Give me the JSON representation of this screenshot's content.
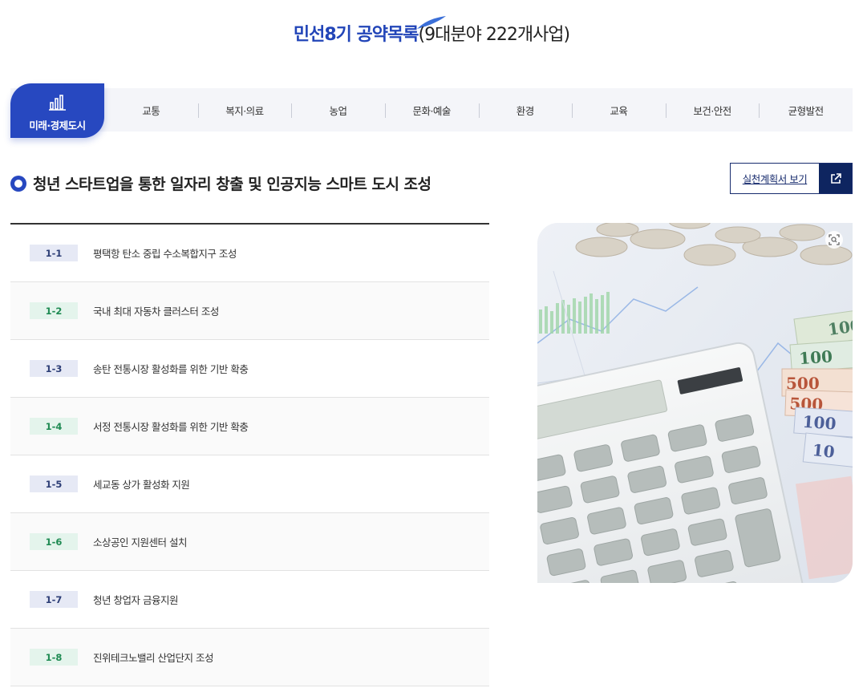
{
  "header": {
    "title_bold": "민선8기 공약목록",
    "title_rest": "(9대분야 222개사업)"
  },
  "nav": {
    "active": {
      "label": "미래·경제도시",
      "icon": "bar-chart-icon"
    },
    "items": [
      "교통",
      "복지·의료",
      "농업",
      "문화·예술",
      "환경",
      "교육",
      "보건·안전",
      "균형발전"
    ]
  },
  "section": {
    "title": "청년 스타트업을 통한 일자리 창출 및 인공지능 스마트 도시 조성",
    "plan_button": "실천계획서 보기",
    "plan_icon": "external-link-icon"
  },
  "pledges": [
    {
      "code": "1-1",
      "text": "평택항 탄소 중립 수소복합지구 조성",
      "tone": "blue"
    },
    {
      "code": "1-2",
      "text": "국내 최대 자동차 클러스터 조성",
      "tone": "green"
    },
    {
      "code": "1-3",
      "text": "송탄 전통시장 활성화를 위한 기반 확충",
      "tone": "blue"
    },
    {
      "code": "1-4",
      "text": "서정 전통시장 활성화를 위한 기반 확충",
      "tone": "green"
    },
    {
      "code": "1-5",
      "text": "세교동 상가 활성화 지원",
      "tone": "blue"
    },
    {
      "code": "1-6",
      "text": "소상공인 지원센터 설치",
      "tone": "green"
    },
    {
      "code": "1-7",
      "text": "청년 창업자 금융지원",
      "tone": "blue"
    },
    {
      "code": "1-8",
      "text": "진위테크노밸리 산업단지 조성",
      "tone": "green"
    }
  ],
  "photo": {
    "zoom_icon": "zoom-icon",
    "banknote_labels": [
      "100",
      "100",
      "500",
      "500",
      "100",
      "10"
    ]
  },
  "colors": {
    "primary": "#2748c0",
    "navy": "#0e2560",
    "badge_blue_bg": "#e6e9f5",
    "badge_green_bg": "#e4f4ec"
  }
}
